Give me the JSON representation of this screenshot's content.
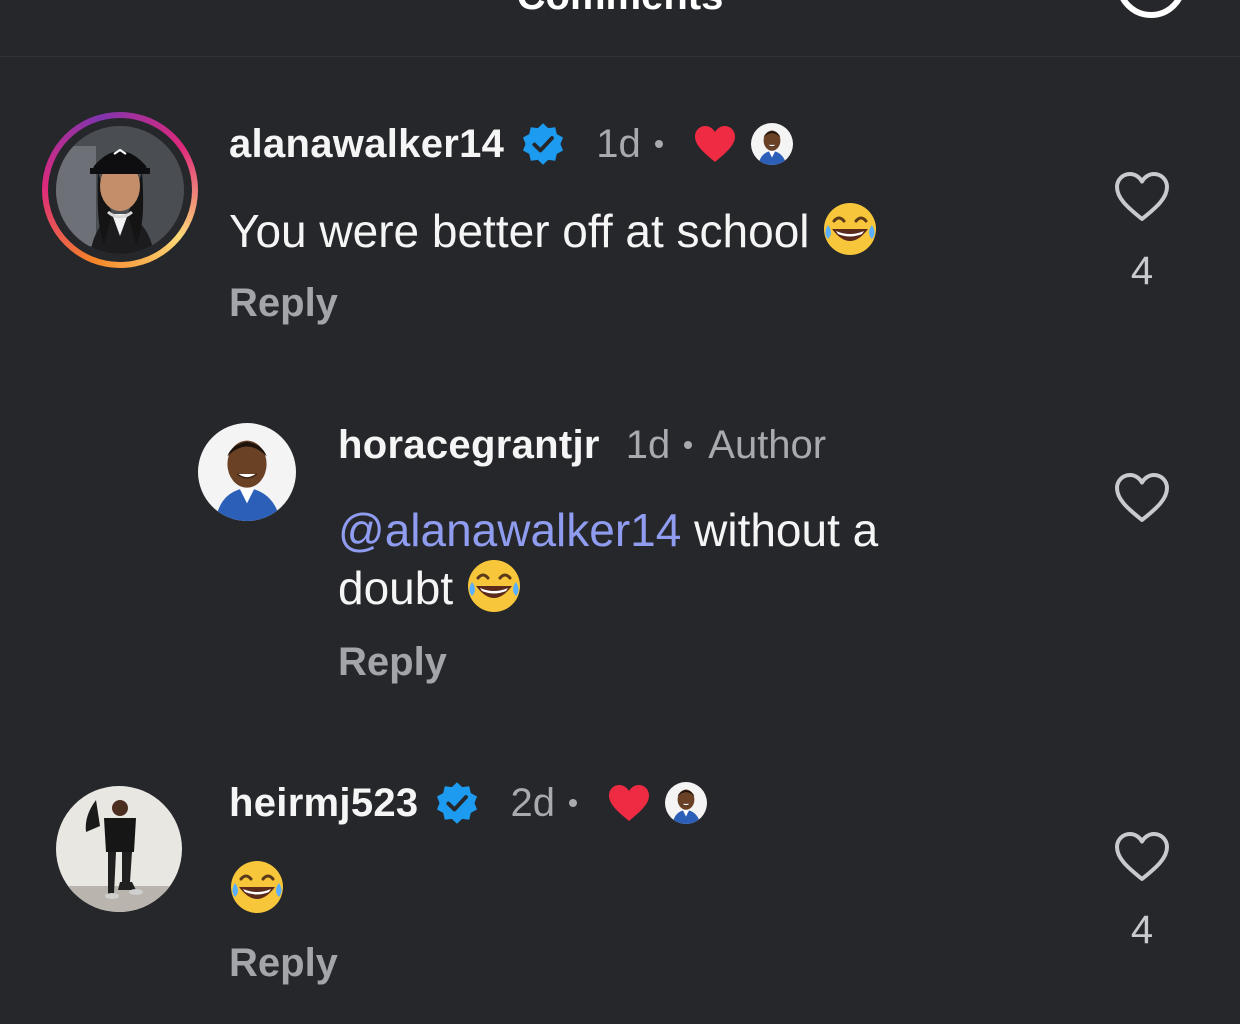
{
  "header": {
    "title": "Comments"
  },
  "comments": [
    {
      "username": "alanawalker14",
      "verified": true,
      "time": "1d",
      "liked_by_author": true,
      "text": "You were better off at school",
      "reply_label": "Reply",
      "like_count": "4"
    },
    {
      "username": "horacegrantjr",
      "time": "1d",
      "author_badge": "Author",
      "mention": "@alanawalker14",
      "text_line1_rest": " without a",
      "text_line2": "doubt",
      "reply_label": "Reply"
    },
    {
      "username": "heirmj523",
      "verified": true,
      "time": "2d",
      "liked_by_author": true,
      "reply_label": "Reply",
      "like_count": "4"
    }
  ],
  "colors": {
    "background": "#25272b",
    "mention": "#8f9cf0",
    "verified": "#1d9bf0",
    "heart": "#ef2b43"
  }
}
